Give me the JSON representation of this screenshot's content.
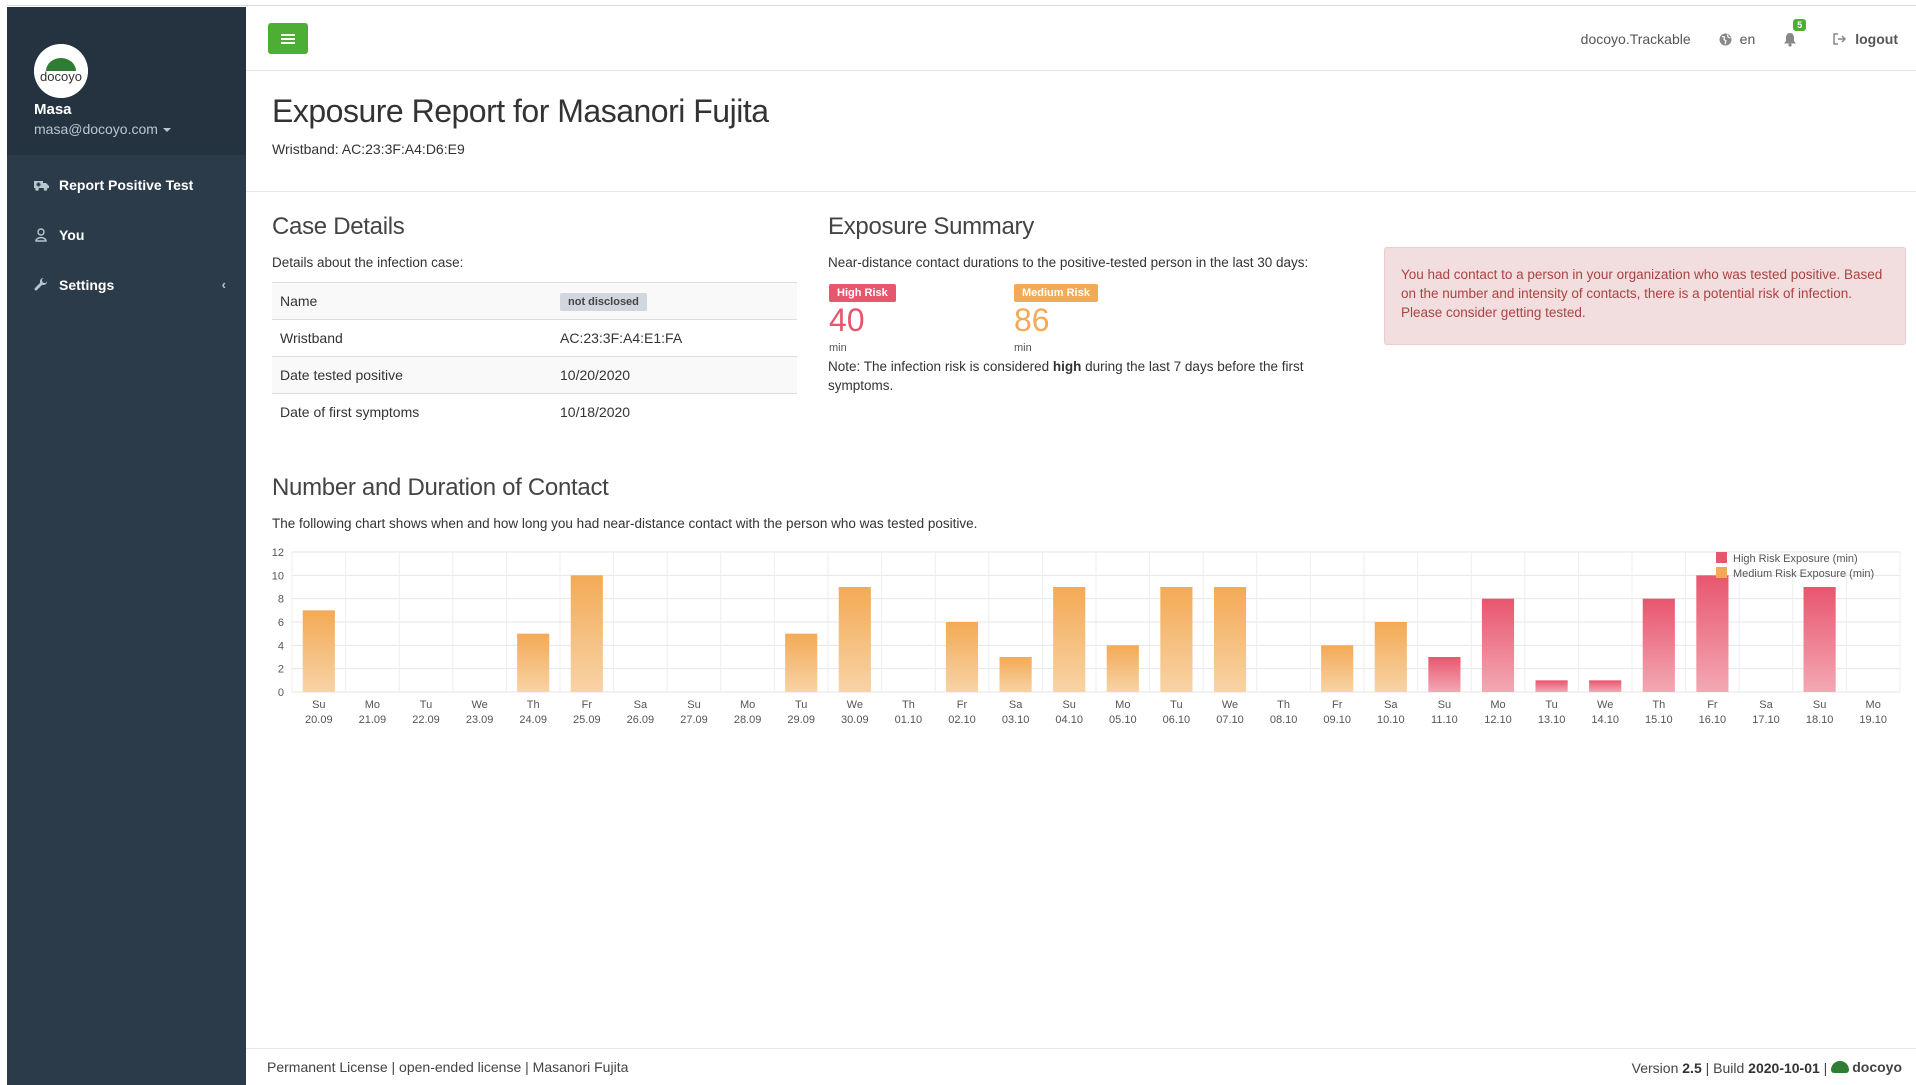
{
  "sidebar": {
    "user_name": "Masa",
    "user_email": "masa@docoyo.com",
    "logo_text": "docoyo",
    "items": [
      {
        "label": "Report Positive Test",
        "icon": "ambulance-icon"
      },
      {
        "label": "You",
        "icon": "user-icon"
      },
      {
        "label": "Settings",
        "icon": "wrench-icon"
      }
    ]
  },
  "header": {
    "app_name": "docoyo.Trackable",
    "language": "en",
    "notification_count": "5",
    "logout_label": "logout"
  },
  "page": {
    "title": "Exposure Report for Masanori Fujita",
    "wristband_line": "Wristband: AC:23:3F:A4:D6:E9"
  },
  "case_details": {
    "title": "Case Details",
    "description": "Details about the infection case:",
    "rows": [
      {
        "key": "Name",
        "value": "not disclosed"
      },
      {
        "key": "Wristband",
        "value": "AC:23:3F:A4:E1:FA"
      },
      {
        "key": "Date tested positive",
        "value": "10/20/2020"
      },
      {
        "key": "Date of first symptoms",
        "value": "10/18/2020"
      }
    ]
  },
  "exposure_summary": {
    "title": "Exposure Summary",
    "description": "Near-distance contact durations to the positive-tested person in the last 30 days:",
    "high_label": "High Risk",
    "high_value": "40",
    "high_unit": "min",
    "medium_label": "Medium Risk",
    "medium_value": "86",
    "medium_unit": "min",
    "note_prefix": "Note: The infection risk is considered ",
    "note_bold": "high",
    "note_suffix": " during the last 7 days before the first symptoms."
  },
  "alert": {
    "text": "You had contact to a person in your organization who was tested positive. Based on the number and intensity of contacts, there is a potential risk of infection. Please consider getting tested."
  },
  "contact_section": {
    "title": "Number and Duration of Contact",
    "description": "The following chart shows when and how long you had near-distance contact with the person who was tested positive."
  },
  "colors": {
    "high": "#e8566e",
    "medium": "#f3aa55",
    "alert_bg": "#f2dede",
    "alert_text": "#a94442",
    "sidebar": "#2c3b49",
    "accent_green": "#4caf33"
  },
  "chart_data": {
    "type": "bar",
    "stacked": true,
    "categories": [
      [
        "Su",
        "20.09"
      ],
      [
        "Mo",
        "21.09"
      ],
      [
        "Tu",
        "22.09"
      ],
      [
        "We",
        "23.09"
      ],
      [
        "Th",
        "24.09"
      ],
      [
        "Fr",
        "25.09"
      ],
      [
        "Sa",
        "26.09"
      ],
      [
        "Su",
        "27.09"
      ],
      [
        "Mo",
        "28.09"
      ],
      [
        "Tu",
        "29.09"
      ],
      [
        "We",
        "30.09"
      ],
      [
        "Th",
        "01.10"
      ],
      [
        "Fr",
        "02.10"
      ],
      [
        "Sa",
        "03.10"
      ],
      [
        "Su",
        "04.10"
      ],
      [
        "Mo",
        "05.10"
      ],
      [
        "Tu",
        "06.10"
      ],
      [
        "We",
        "07.10"
      ],
      [
        "Th",
        "08.10"
      ],
      [
        "Fr",
        "09.10"
      ],
      [
        "Sa",
        "10.10"
      ],
      [
        "Su",
        "11.10"
      ],
      [
        "Mo",
        "12.10"
      ],
      [
        "Tu",
        "13.10"
      ],
      [
        "We",
        "14.10"
      ],
      [
        "Th",
        "15.10"
      ],
      [
        "Fr",
        "16.10"
      ],
      [
        "Sa",
        "17.10"
      ],
      [
        "Su",
        "18.10"
      ],
      [
        "Mo",
        "19.10"
      ]
    ],
    "series": [
      {
        "name": "High Risk Exposure (min)",
        "values": [
          0,
          0,
          0,
          0,
          0,
          0,
          0,
          0,
          0,
          0,
          0,
          0,
          0,
          0,
          0,
          0,
          0,
          0,
          0,
          0,
          0,
          3,
          8,
          1,
          1,
          8,
          10,
          0,
          9,
          0
        ]
      },
      {
        "name": "Medium Risk Exposure (min)",
        "values": [
          7,
          0,
          0,
          0,
          5,
          10,
          0,
          0,
          0,
          5,
          9,
          0,
          6,
          3,
          9,
          4,
          9,
          9,
          0,
          4,
          6,
          0,
          0,
          0,
          0,
          0,
          0,
          0,
          0,
          0
        ]
      }
    ],
    "ylim": [
      0,
      12
    ],
    "yticks": [
      0,
      2,
      4,
      6,
      8,
      10,
      12
    ],
    "legend": "top-right",
    "grid": true
  }
}
